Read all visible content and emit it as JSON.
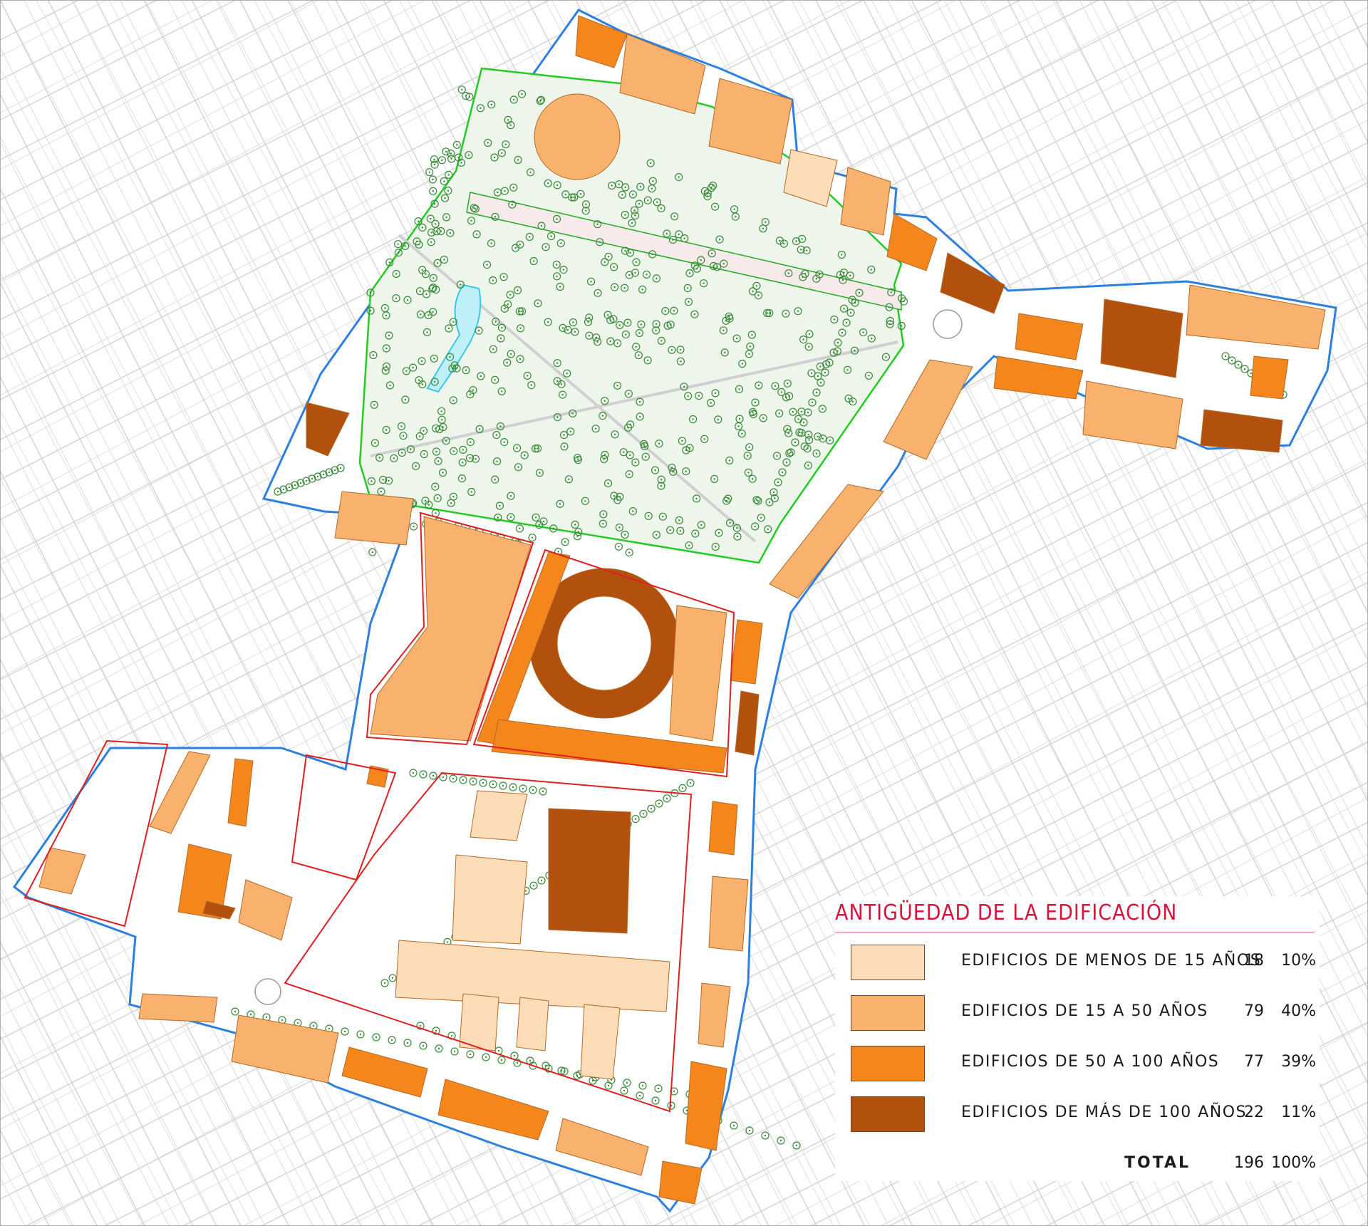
{
  "legend": {
    "title": "ANTIGÜEDAD DE LA EDIFICACIÓN",
    "items": [
      {
        "label": "EDIFICIOS DE MENOS DE 15 AÑOS",
        "count": "18",
        "percent": "10%",
        "color": "#fddcb8"
      },
      {
        "label": "EDIFICIOS DE 15 A 50 AÑOS",
        "count": "79",
        "percent": "40%",
        "color": "#f8b26e"
      },
      {
        "label": "EDIFICIOS DE 50 A 100 AÑOS",
        "count": "77",
        "percent": "39%",
        "color": "#f5861c"
      },
      {
        "label": "EDIFICIOS DE MÁS DE 100 AÑOS",
        "count": "22",
        "percent": "11%",
        "color": "#b2500e"
      }
    ],
    "total": {
      "label": "TOTAL",
      "count": "196",
      "percent": "100%"
    }
  },
  "colors": {
    "study_boundary": "#2d7fe0",
    "block_outline": "#e02020",
    "park_outline": "#22cc22",
    "tree_symbol": "#3a8a3a",
    "water": "#3ac8e8",
    "street_grid": "#c8c8c8"
  }
}
